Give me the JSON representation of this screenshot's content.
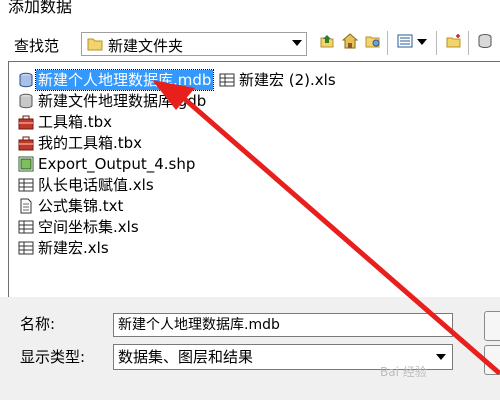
{
  "window": {
    "title": "添加数据"
  },
  "toolbar": {
    "lookin_label": "查找范",
    "location": "新建文件夹"
  },
  "files": [
    {
      "name": "新建个人地理数据库.mdb",
      "icon": "personal-geodatabase-icon",
      "selected": true
    },
    {
      "name": "新建文件地理数据库.gdb",
      "icon": "file-geodatabase-icon",
      "selected": false
    },
    {
      "name": "工具箱.tbx",
      "icon": "toolbox-icon",
      "selected": false
    },
    {
      "name": "我的工具箱.tbx",
      "icon": "toolbox-icon",
      "selected": false
    },
    {
      "name": "Export_Output_4.shp",
      "icon": "shapefile-icon",
      "selected": false
    },
    {
      "name": "队长电话赋值.xls",
      "icon": "table-icon",
      "selected": false
    },
    {
      "name": "公式集锦.txt",
      "icon": "text-file-icon",
      "selected": false
    },
    {
      "name": "空间坐标集.xls",
      "icon": "table-icon",
      "selected": false
    },
    {
      "name": "新建宏.xls",
      "icon": "table-icon",
      "selected": false
    },
    {
      "name": "新建宏 (2).xls",
      "icon": "table-icon",
      "selected": false
    }
  ],
  "form": {
    "name_label": "名称:",
    "name_value": "新建个人地理数据库.mdb",
    "type_label": "显示类型:",
    "type_value": "数据集、图层和结果"
  },
  "annotation": {
    "arrow_color": "#e8201d"
  },
  "watermark": "Bai 经验"
}
